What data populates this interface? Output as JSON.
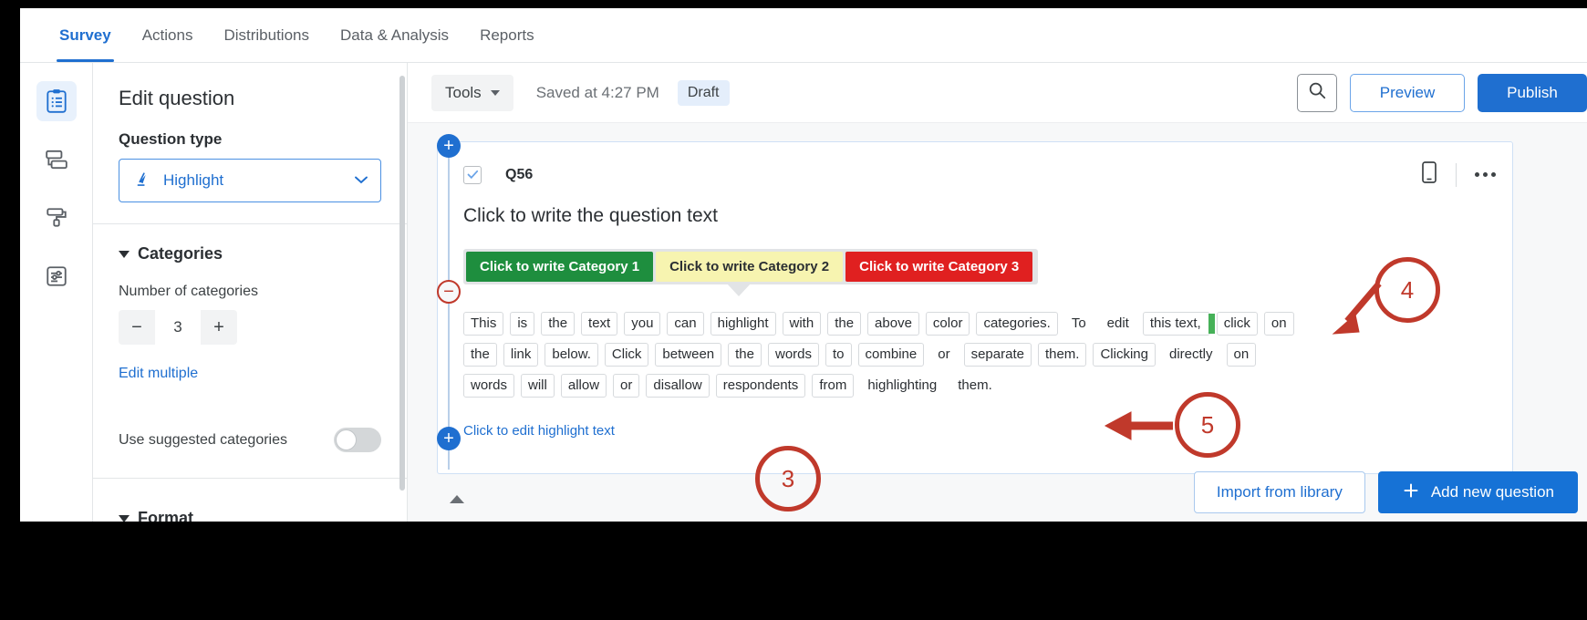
{
  "nav": {
    "tabs": [
      {
        "label": "Survey",
        "active": true
      },
      {
        "label": "Actions",
        "active": false
      },
      {
        "label": "Distributions",
        "active": false
      },
      {
        "label": "Data & Analysis",
        "active": false
      },
      {
        "label": "Reports",
        "active": false
      }
    ]
  },
  "rail": {
    "items": [
      {
        "icon": "clipboard-list-icon",
        "active": true
      },
      {
        "icon": "survey-flow-icon",
        "active": false
      },
      {
        "icon": "paint-roller-icon",
        "active": false
      },
      {
        "icon": "sliders-document-icon",
        "active": false
      }
    ]
  },
  "panel": {
    "title": "Edit question",
    "question_type_label": "Question type",
    "question_type_value": "Highlight",
    "categories_section": "Categories",
    "number_of_categories_label": "Number of categories",
    "number_of_categories_value": "3",
    "minus_label": "−",
    "plus_label": "+",
    "edit_multiple_label": "Edit multiple",
    "use_suggested_label": "Use suggested categories",
    "use_suggested_on": false,
    "format_section": "Format"
  },
  "toolbar": {
    "tools_label": "Tools",
    "saved_label": "Saved at 4:27 PM",
    "draft_label": "Draft",
    "search_icon": "search-icon",
    "preview_label": "Preview",
    "publish_label": "Publish"
  },
  "question": {
    "id": "Q56",
    "text": "Click to write the question text",
    "mobile_icon": "mobile-preview-icon",
    "more_icon": "ellipsis-icon",
    "categories": [
      {
        "label": "Click to write Category 1",
        "bg": "#1e8e3e",
        "fg": "#ffffff"
      },
      {
        "label": "Click to write Category 2",
        "bg": "#f7f4b0",
        "fg": "#2b2f33"
      },
      {
        "label": "Click to write Category 3",
        "bg": "#e02020",
        "fg": "#ffffff"
      }
    ],
    "edit_highlight_link": "Click to edit highlight text",
    "highlight_lines": [
      [
        {
          "t": "This",
          "box": true
        },
        {
          "t": "is",
          "box": true
        },
        {
          "t": "the",
          "box": true
        },
        {
          "t": "text",
          "box": true
        },
        {
          "t": "you",
          "box": true
        },
        {
          "t": "can",
          "box": true
        },
        {
          "t": "highlight",
          "box": true
        },
        {
          "t": "with",
          "box": true
        },
        {
          "t": "the",
          "box": true
        },
        {
          "t": "above",
          "box": true
        },
        {
          "t": "color",
          "box": true
        },
        {
          "t": "categories.",
          "box": true
        },
        {
          "t": "To",
          "box": false
        },
        {
          "t": "edit",
          "box": false
        },
        {
          "t": "this text,",
          "box": true,
          "cursor": true
        },
        {
          "t": "click",
          "box": true
        },
        {
          "t": "on",
          "box": true
        }
      ],
      [
        {
          "t": "the",
          "box": true
        },
        {
          "t": "link",
          "box": true
        },
        {
          "t": "below.",
          "box": true
        },
        {
          "t": "Click",
          "box": true
        },
        {
          "t": "between",
          "box": true
        },
        {
          "t": "the",
          "box": true
        },
        {
          "t": "words",
          "box": true
        },
        {
          "t": "to",
          "box": true
        },
        {
          "t": "combine",
          "box": true
        },
        {
          "t": "or",
          "box": false
        },
        {
          "t": "separate",
          "box": true
        },
        {
          "t": "them.",
          "box": true
        },
        {
          "t": "Clicking",
          "box": true
        },
        {
          "t": "directly",
          "box": false
        },
        {
          "t": "on",
          "box": true
        }
      ],
      [
        {
          "t": "words",
          "box": true
        },
        {
          "t": "will",
          "box": true
        },
        {
          "t": "allow",
          "box": true
        },
        {
          "t": "or",
          "box": true
        },
        {
          "t": "disallow",
          "box": true
        },
        {
          "t": "respondents",
          "box": true
        },
        {
          "t": "from",
          "box": true
        },
        {
          "t": "highlighting",
          "box": false
        },
        {
          "t": "them.",
          "box": false
        }
      ]
    ]
  },
  "footer": {
    "import_label": "Import from library",
    "add_question_label": "Add new question",
    "add_icon": "plus-icon"
  },
  "annotations": [
    {
      "number": "3"
    },
    {
      "number": "4"
    },
    {
      "number": "5"
    }
  ],
  "colors": {
    "accent": "#1f6fd0",
    "marker_red": "#c0392b",
    "category_green": "#1e8e3e",
    "category_yellow": "#f7f4b0",
    "category_red": "#e02020",
    "cursor_green": "#46b158"
  }
}
